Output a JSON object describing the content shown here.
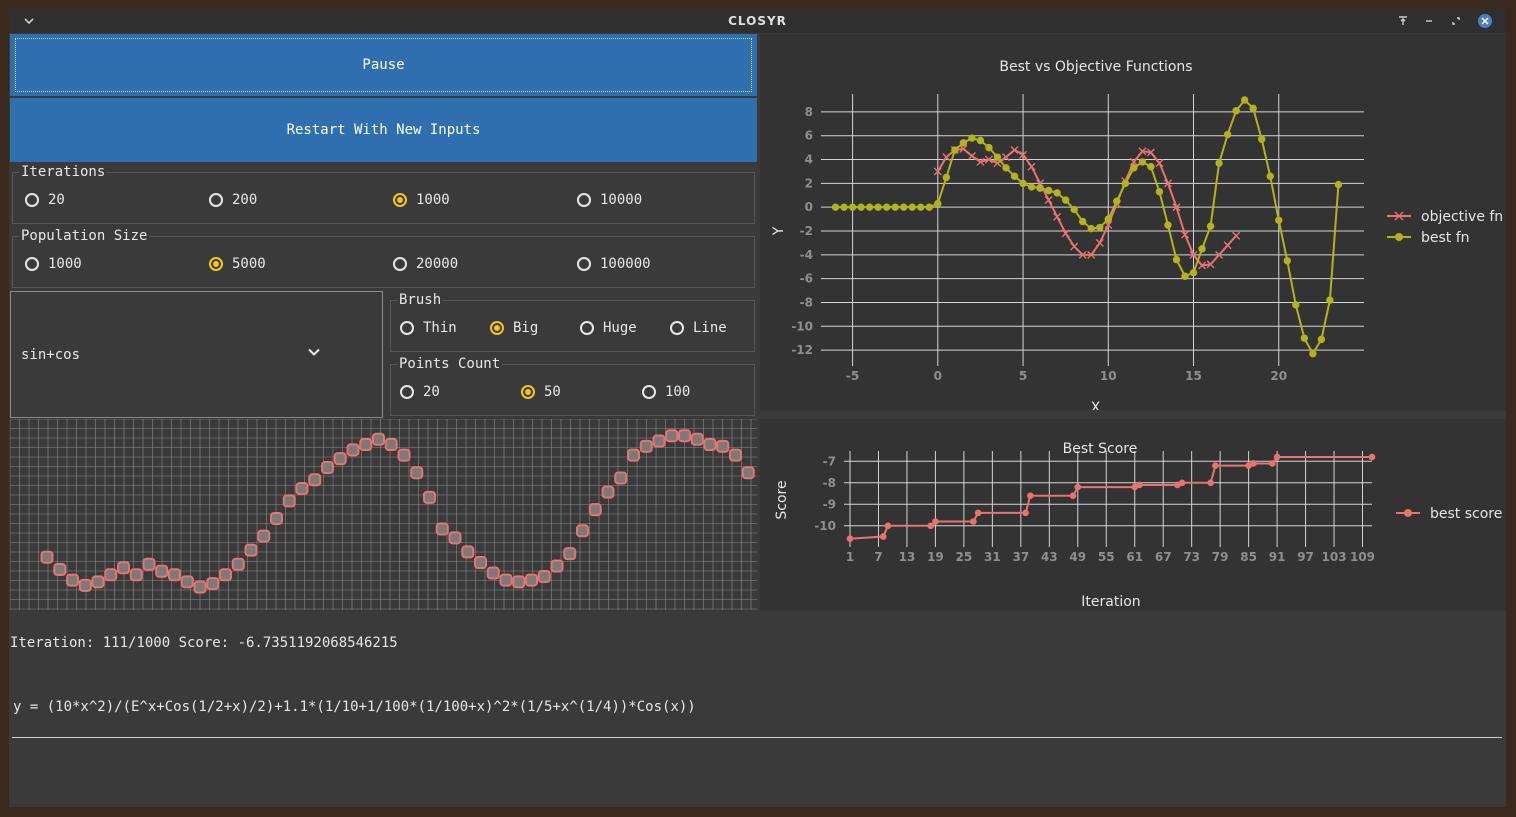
{
  "window": {
    "title": "CLOSYR"
  },
  "controls": {
    "pause_label": "Pause",
    "restart_label": "Restart With New Inputs"
  },
  "iterations": {
    "title": "Iterations",
    "options": [
      "20",
      "200",
      "1000",
      "10000"
    ],
    "selected": "1000"
  },
  "population": {
    "title": "Population Size",
    "options": [
      "1000",
      "5000",
      "20000",
      "100000"
    ],
    "selected": "5000"
  },
  "function_select": {
    "value": "sin+cos"
  },
  "brush": {
    "title": "Brush",
    "options": [
      "Thin",
      "Big",
      "Huge",
      "Line"
    ],
    "selected": "Big"
  },
  "points_count": {
    "title": "Points Count",
    "options": [
      "20",
      "50",
      "100"
    ],
    "selected": "50"
  },
  "status": {
    "iteration_line": "Iteration: 111/1000 Score: -6.7351192068546215",
    "formula": "y = (10*x^2)/(E^x+Cos(1/2+x)/2)+1.1*(1/10+1/100*(1/100+x)^2*(1/5+x^(1/4))*Cos(x))"
  },
  "colors": {
    "accent": "#2f6fb0",
    "radio_selected": "#f5c518",
    "objective": "#e8736f",
    "best": "#b3b31a"
  },
  "chart_data": [
    {
      "type": "line",
      "title": "Best vs Objective Functions",
      "xlabel": "X",
      "ylabel": "Y",
      "xlim": [
        -6.5,
        25
      ],
      "ylim": [
        -13,
        9
      ],
      "x_ticks": [
        -5,
        0,
        5,
        10,
        15,
        20
      ],
      "y_ticks": [
        8,
        6,
        4,
        2,
        0,
        -2,
        -4,
        -6,
        -8,
        -10,
        -12
      ],
      "legend_position": "right",
      "series": [
        {
          "name": "objective fn",
          "marker": "x",
          "x": [
            0,
            0.5,
            1,
            1.5,
            2,
            2.5,
            3,
            3.5,
            4,
            4.5,
            5,
            5.5,
            6,
            6.5,
            7,
            7.5,
            8,
            8.5,
            9,
            9.5,
            10,
            10.5,
            11,
            11.5,
            12,
            12.5,
            13,
            13.5,
            14,
            14.5,
            15,
            15.5,
            16,
            16.5,
            17,
            17.5
          ],
          "y": [
            3,
            4.2,
            4.8,
            4.9,
            4.3,
            3.8,
            4,
            3.7,
            4.2,
            4.8,
            4.4,
            3.4,
            2,
            0.6,
            -0.8,
            -2.2,
            -3.3,
            -4,
            -4,
            -3,
            -1.5,
            0.3,
            2.2,
            3.8,
            4.7,
            4.6,
            3.7,
            2,
            0,
            -2.3,
            -4,
            -4.9,
            -4.8,
            -4,
            -3.2,
            -2.4
          ]
        },
        {
          "name": "best fn",
          "marker": "circle",
          "x": [
            -6,
            -5.5,
            -5,
            -4.5,
            -4,
            -3.5,
            -3,
            -2.5,
            -2,
            -1.5,
            -1,
            -0.5,
            0,
            0.5,
            1,
            1.5,
            2,
            2.5,
            3,
            3.5,
            4,
            4.5,
            5,
            5.5,
            6,
            6.5,
            7,
            7.5,
            8,
            8.5,
            9,
            9.5,
            10,
            10.5,
            11,
            11.5,
            12,
            12.5,
            13,
            13.5,
            14,
            14.5,
            15,
            15.5,
            16,
            16.5,
            17,
            17.5,
            18,
            18.5,
            19,
            19.5,
            20,
            20.5,
            21,
            21.5,
            22,
            22.5,
            23,
            23.5
          ],
          "y": [
            0,
            0,
            0,
            0,
            0,
            0,
            0,
            0,
            0,
            0,
            0,
            0,
            0.3,
            2.5,
            4.8,
            5.4,
            5.8,
            5.6,
            5,
            4.2,
            3.3,
            2.6,
            2,
            1.7,
            1.6,
            1.4,
            1.2,
            0.6,
            -0.2,
            -1.2,
            -1.8,
            -1.7,
            -1,
            0.5,
            2,
            3.3,
            3.8,
            3.4,
            1.3,
            -1.5,
            -4.4,
            -5.8,
            -5.5,
            -3.5,
            -1.6,
            3.7,
            6.1,
            8.1,
            9,
            8.3,
            5.7,
            2.6,
            -1.1,
            -4.5,
            -8.2,
            -11,
            -12.3,
            -11.1,
            -7.8,
            1.9
          ]
        }
      ]
    },
    {
      "type": "line",
      "title": "Best Score",
      "xlabel": "Iteration",
      "ylabel": "Score",
      "xlim": [
        1,
        111
      ],
      "ylim": [
        -10.8,
        -6.8
      ],
      "x_ticks": [
        1,
        7,
        13,
        19,
        25,
        31,
        37,
        43,
        49,
        55,
        61,
        67,
        73,
        79,
        85,
        91,
        97,
        103,
        109
      ],
      "y_ticks": [
        -7,
        -8,
        -9,
        -10
      ],
      "legend_position": "right",
      "series": [
        {
          "name": "best score",
          "marker": "circle",
          "x": [
            1,
            8,
            9,
            18,
            19,
            27,
            28,
            38,
            39,
            48,
            49,
            61,
            62,
            70,
            71,
            77,
            78,
            85,
            86,
            90,
            91,
            111
          ],
          "y": [
            -10.6,
            -10.5,
            -10,
            -10,
            -9.8,
            -9.8,
            -9.4,
            -9.4,
            -8.6,
            -8.6,
            -8.2,
            -8.2,
            -8.1,
            -8.1,
            -8,
            -8,
            -7.2,
            -7.2,
            -7.1,
            -7.1,
            -6.8,
            -6.8
          ]
        }
      ]
    }
  ],
  "brush_canvas": {
    "points": [
      [
        2,
        3
      ],
      [
        3.5,
        2.3
      ],
      [
        5,
        1.7
      ],
      [
        6.5,
        1.4
      ],
      [
        8,
        1.6
      ],
      [
        9.5,
        2
      ],
      [
        11,
        2.4
      ],
      [
        12.5,
        2
      ],
      [
        14,
        2.6
      ],
      [
        15.5,
        2.2
      ],
      [
        17,
        2
      ],
      [
        18.5,
        1.6
      ],
      [
        20,
        1.3
      ],
      [
        21.5,
        1.5
      ],
      [
        23,
        2
      ],
      [
        24.5,
        2.6
      ],
      [
        26,
        3.4
      ],
      [
        27.5,
        4.2
      ],
      [
        29,
        5.2
      ],
      [
        30.5,
        6.2
      ],
      [
        32,
        6.9
      ],
      [
        33.5,
        7.4
      ],
      [
        35,
        8.1
      ],
      [
        36.5,
        8.6
      ],
      [
        38,
        9.1
      ],
      [
        39.5,
        9.4
      ],
      [
        41,
        9.7
      ],
      [
        42.5,
        9.4
      ],
      [
        44,
        8.8
      ],
      [
        45.5,
        7.8
      ],
      [
        47,
        6.4
      ],
      [
        48.5,
        4.6
      ],
      [
        50,
        4.1
      ],
      [
        51.5,
        3.3
      ],
      [
        53,
        2.7
      ],
      [
        54.5,
        2.1
      ],
      [
        56,
        1.7
      ],
      [
        57.5,
        1.6
      ],
      [
        59,
        1.7
      ],
      [
        60.5,
        1.9
      ],
      [
        62,
        2.5
      ],
      [
        63.5,
        3.2
      ],
      [
        65,
        4.5
      ],
      [
        66.5,
        5.7
      ],
      [
        68,
        6.7
      ],
      [
        69.5,
        7.5
      ],
      [
        71,
        8.8
      ],
      [
        72.5,
        9.3
      ],
      [
        74,
        9.6
      ],
      [
        75.5,
        9.9
      ],
      [
        77,
        9.9
      ],
      [
        78.5,
        9.7
      ],
      [
        80,
        9.4
      ],
      [
        81.5,
        9.3
      ],
      [
        83,
        8.8
      ],
      [
        84.5,
        7.8
      ]
    ]
  }
}
